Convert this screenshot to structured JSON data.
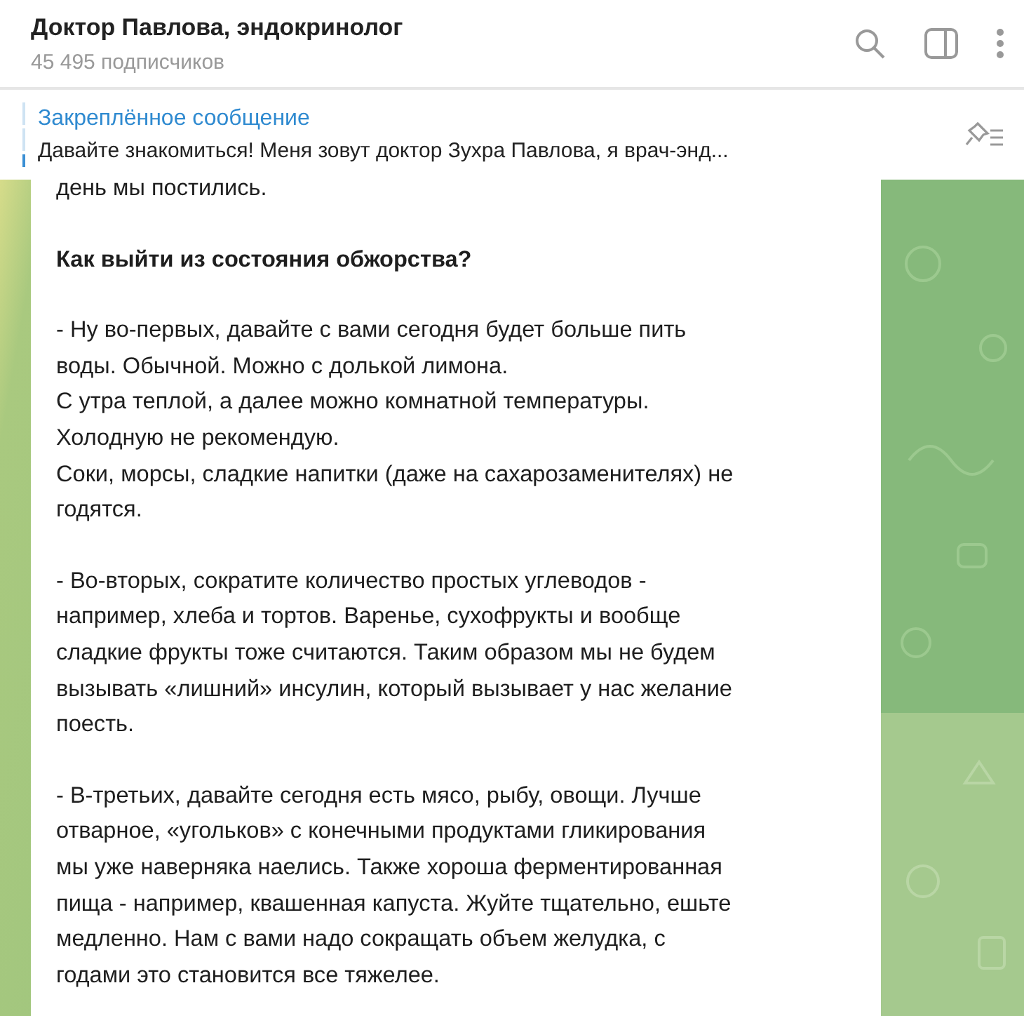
{
  "header": {
    "title": "Доктор Павлова, эндокринолог",
    "subtitle": "45 495 подписчиков"
  },
  "pinned": {
    "title": "Закреплённое сообщение",
    "text": "Давайте знакомиться!  Меня зовут доктор Зухра Павлова, я врач-энд..."
  },
  "message": {
    "blocks": [
      {
        "kind": "text",
        "lines": [
          "день мы постились."
        ]
      },
      {
        "kind": "heading",
        "lines": [
          "Как выйти из состояния обжорства?"
        ]
      },
      {
        "kind": "text",
        "lines": [
          "- Ну во-первых, давайте с вами сегодня будет больше пить",
          "воды. Обычной. Можно с долькой лимона.",
          "С утра теплой, а далее можно комнатной температуры.",
          "Холодную не рекомендую.",
          "Соки, морсы, сладкие напитки (даже на сахарозаменителях) не",
          "годятся."
        ]
      },
      {
        "kind": "text",
        "lines": [
          "- Во-вторых, сократите количество простых углеводов -",
          "например, хлеба и тортов. Варенье, сухофрукты и вообще",
          "сладкие фрукты тоже считаются. Таким образом мы не будем",
          "вызывать «лишний» инсулин, который вызывает у нас желание",
          "поесть."
        ]
      },
      {
        "kind": "text",
        "lines": [
          "- В-третьих, давайте сегодня есть мясо, рыбу, овощи. Лучше",
          "отварное, «угольков» с конечными продуктами гликирования",
          "мы уже наверняка наелись. Также хороша ферментированная",
          "пища - например, квашенная капуста. Жуйте тщательно, ешьте",
          "медленно. Нам с вами надо сокращать объем желудка, с",
          "годами это становится все тяжелее."
        ]
      }
    ]
  }
}
